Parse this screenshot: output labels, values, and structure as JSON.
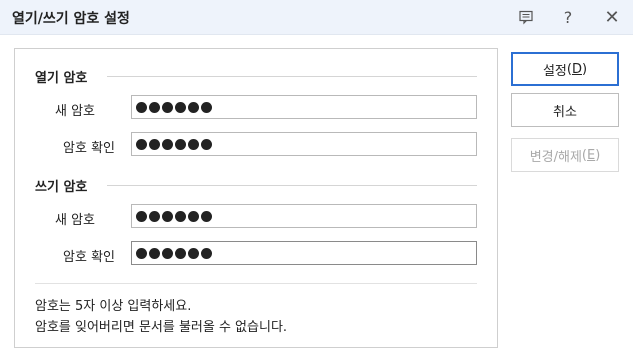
{
  "window": {
    "title": "열기/쓰기 암호 설정",
    "icons": {
      "memo": "comment-icon",
      "help": "help-icon",
      "close": "close-icon"
    },
    "help_glyph": "?",
    "close_glyph": "✕"
  },
  "open_section": {
    "title": "열기 암호",
    "new_label": "새 암호",
    "confirm_label": "암호 확인",
    "new_dots": 6,
    "confirm_dots": 6
  },
  "write_section": {
    "title": "쓰기 암호",
    "new_label": "새 암호",
    "confirm_label": "암호 확인",
    "new_dots": 6,
    "confirm_dots": 6
  },
  "notes": {
    "line1": "암호는 5자 이상 입력하세요.",
    "line2": "암호를 잊어버리면 문서를 불러올 수 없습니다."
  },
  "buttons": {
    "set": {
      "label": "설정",
      "accesskey": "D"
    },
    "cancel": {
      "label": "취소"
    },
    "change": {
      "label": "변경/해제",
      "accesskey": "E",
      "disabled": true
    }
  },
  "colors": {
    "accent": "#2b6fd3",
    "titlebar_bg": "#eef3fb"
  }
}
